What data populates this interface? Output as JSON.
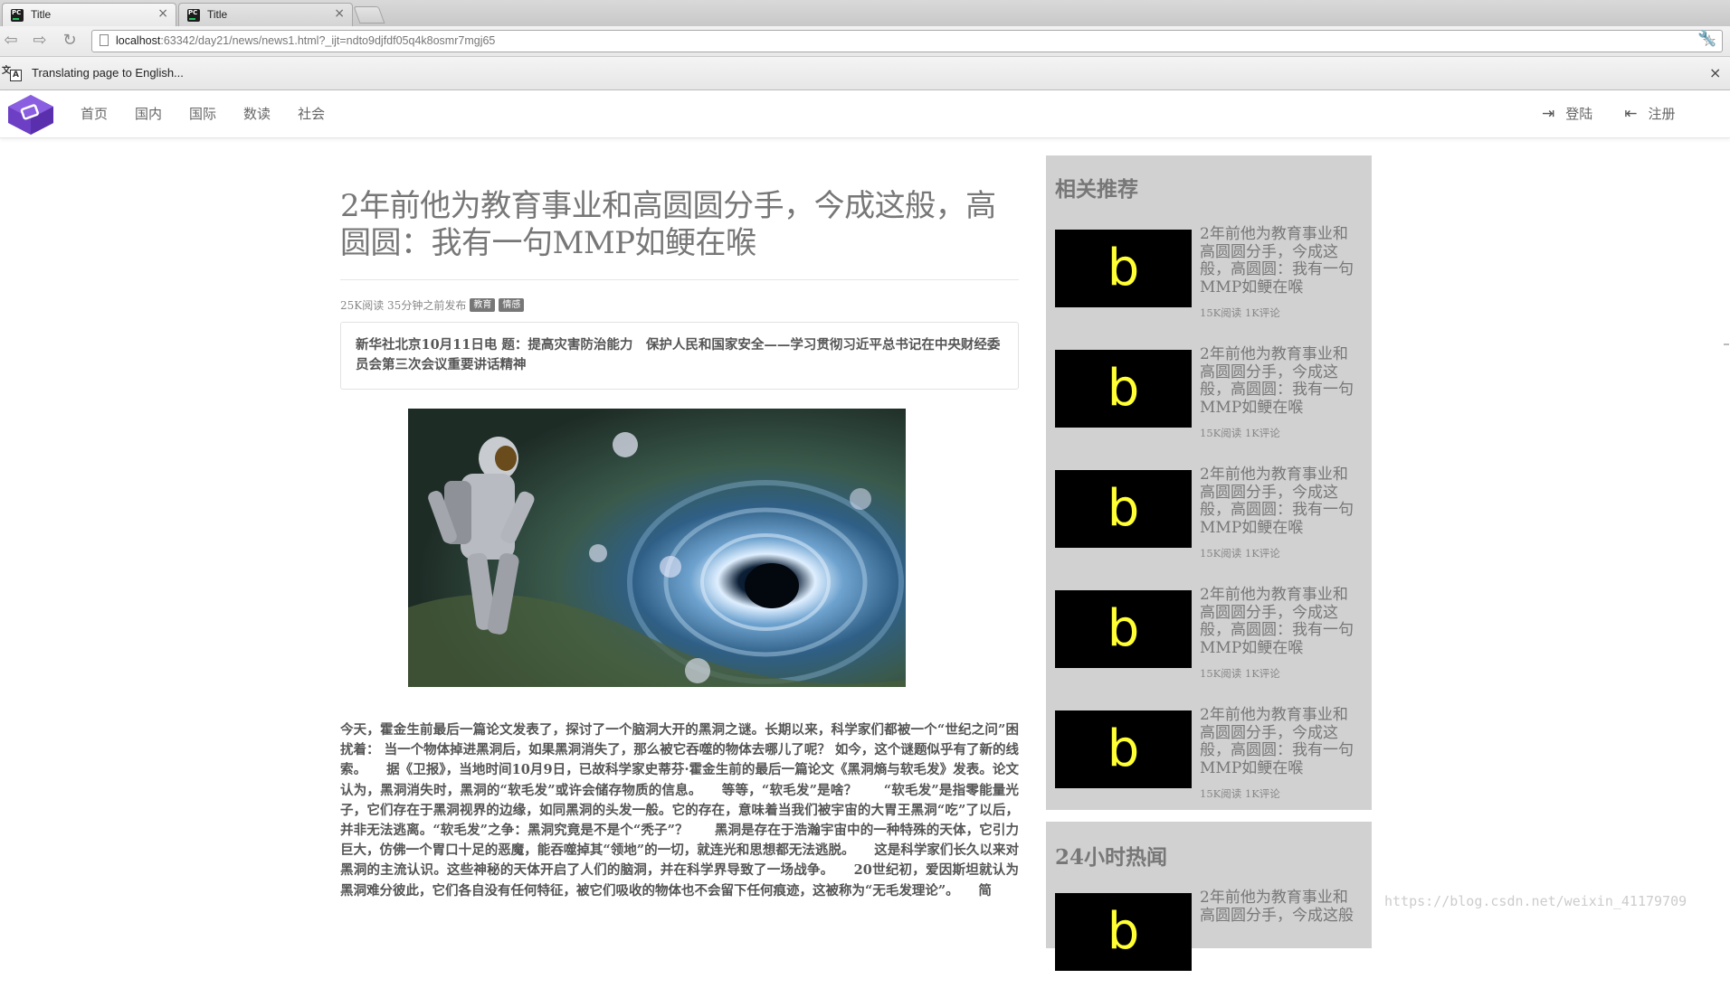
{
  "browser": {
    "tabs": [
      {
        "title": "Title",
        "active": true
      },
      {
        "title": "Title",
        "active": false
      }
    ],
    "url_host": "localhost",
    "url_rest": ":63342/day21/news/news1.html?_ijt=ndto9djfdf05q4k8osmr7mgj65",
    "translate_bar": "Translating page to English..."
  },
  "site": {
    "nav": [
      "首页",
      "国内",
      "国际",
      "数读",
      "社会"
    ],
    "login": "登陆",
    "register": "注册"
  },
  "article": {
    "title": "2年前他为教育事业和高圆圆分手，今成这般，高圆圆：我有一句MMP如鲠在喉",
    "meta": "25K阅读 35分钟之前发布",
    "tags": [
      "教育",
      "情感"
    ],
    "summary": "新华社北京10月11日电 题：提高灾害防治能力　保护人民和国家安全——学习贯彻习近平总书记在中央财经委员会第三次会议重要讲话精神",
    "body": "今天，霍金生前最后一篇论文发表了，探讨了一个脑洞大开的黑洞之谜。长期以来，科学家们都被一个“世纪之问”困扰着： 当一个物体掉进黑洞后，如果黑洞消失了，那么被它吞噬的物体去哪儿了呢？ 如今，这个谜题似乎有了新的线索。　　据《卫报》，当地时间10月9日，已故科学家史蒂芬·霍金生前的最后一篇论文《黑洞熵与软毛发》发表。论文认为，黑洞消失时，黑洞的“软毛发”或许会储存物质的信息。　　等等，“软毛发”是啥？　　“软毛发”是指零能量光子，它们存在于黑洞视界的边缘，如同黑洞的头发一般。它的存在，意味着当我们被宇宙的大胃王黑洞“吃”了以后，并非无法逃离。“软毛发”之争：黑洞究竟是不是个“秃子”？　　黑洞是存在于浩瀚宇宙中的一种特殊的天体，它引力巨大，仿佛一个胃口十足的恶魔，能吞噬掉其“领地”的一切，就连光和思想都无法逃脱。　　这是科学家们长久以来对黑洞的主流认识。这些神秘的天体开启了人们的脑洞，并在科学界导致了一场战争。　　20世纪初，爱因斯坦就认为黑洞难分彼此，它们各自没有任何特征，被它们吸收的物体也不会留下任何痕迹，这被称为“无毛发理论”。　　简"
  },
  "sidebar": {
    "recommend_heading": "相关推荐",
    "hot_heading": "24小时热闻",
    "items": [
      {
        "thumb": "b",
        "title": "2年前他为教育事业和高圆圆分手，今成这般，高圆圆：我有一句MMP如鲠在喉",
        "meta": "15K阅读 1K评论"
      },
      {
        "thumb": "b",
        "title": "2年前他为教育事业和高圆圆分手，今成这般，高圆圆：我有一句MMP如鲠在喉",
        "meta": "15K阅读 1K评论"
      },
      {
        "thumb": "b",
        "title": "2年前他为教育事业和高圆圆分手，今成这般，高圆圆：我有一句MMP如鲠在喉",
        "meta": "15K阅读 1K评论"
      },
      {
        "thumb": "b",
        "title": "2年前他为教育事业和高圆圆分手，今成这般，高圆圆：我有一句MMP如鲠在喉",
        "meta": "15K阅读 1K评论"
      },
      {
        "thumb": "b",
        "title": "2年前他为教育事业和高圆圆分手，今成这般，高圆圆：我有一句MMP如鲠在喉",
        "meta": "15K阅读 1K评论"
      }
    ],
    "hot_items": [
      {
        "thumb": "b",
        "title": "2年前他为教育事业和高圆圆分手，今成这般"
      }
    ]
  },
  "watermark": "https://blog.csdn.net/weixin_41179709",
  "colors": {
    "sidebar_bg": "#d1d1d1",
    "thumb_bg": "#000000",
    "thumb_letter": "#ffff33",
    "logo": "#6c3fc4"
  }
}
